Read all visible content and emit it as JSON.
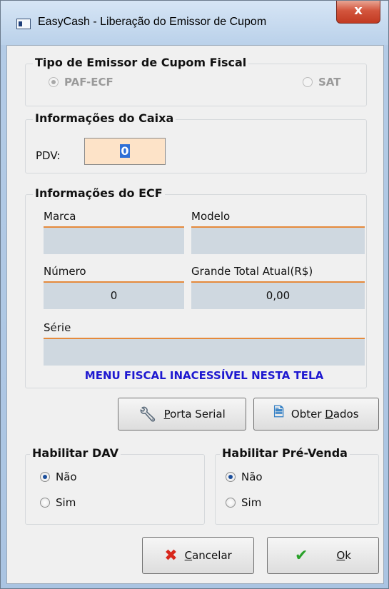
{
  "window": {
    "title": "EasyCash - Liberação do Emissor de Cupom",
    "close_glyph": "x"
  },
  "emissor": {
    "title": "Tipo de Emissor de Cupom Fiscal",
    "options": [
      {
        "label": "PAF-ECF",
        "selected": true
      },
      {
        "label": "SAT",
        "selected": false
      }
    ]
  },
  "caixa": {
    "title": "Informações do Caixa",
    "pdv_label": "PDV:",
    "pdv_value": "0"
  },
  "ecf": {
    "title": "Informações do ECF",
    "marca_label": "Marca",
    "marca_value": "",
    "modelo_label": "Modelo",
    "modelo_value": "",
    "numero_label": "Número",
    "numero_value": "0",
    "grande_total_label": "Grande Total Atual(R$)",
    "grande_total_value": "0,00",
    "serie_label": "Série",
    "serie_value": "",
    "warning": "MENU FISCAL INACESSÍVEL NESTA TELA"
  },
  "actions": {
    "porta_serial": {
      "pre": "",
      "u": "P",
      "post": "orta Serial",
      "icon": "wrench-icon"
    },
    "obter_dados": {
      "pre": "Obter ",
      "u": "D",
      "post": "ados",
      "icon": "document-icon"
    }
  },
  "dav": {
    "title": "Habilitar DAV",
    "options": [
      {
        "label": "Não",
        "selected": true
      },
      {
        "label": "Sim",
        "selected": false
      }
    ]
  },
  "prevenda": {
    "title": "Habilitar Pré-Venda",
    "options": [
      {
        "label": "Não",
        "selected": true
      },
      {
        "label": "Sim",
        "selected": false
      }
    ]
  },
  "footer": {
    "cancelar": {
      "pre": "",
      "u": "C",
      "post": "ancelar",
      "icon": "x-icon",
      "color": "#d8271c"
    },
    "ok": {
      "pre": "",
      "u": "O",
      "post": "k",
      "icon": "check-icon",
      "color": "#2aa12a"
    }
  }
}
